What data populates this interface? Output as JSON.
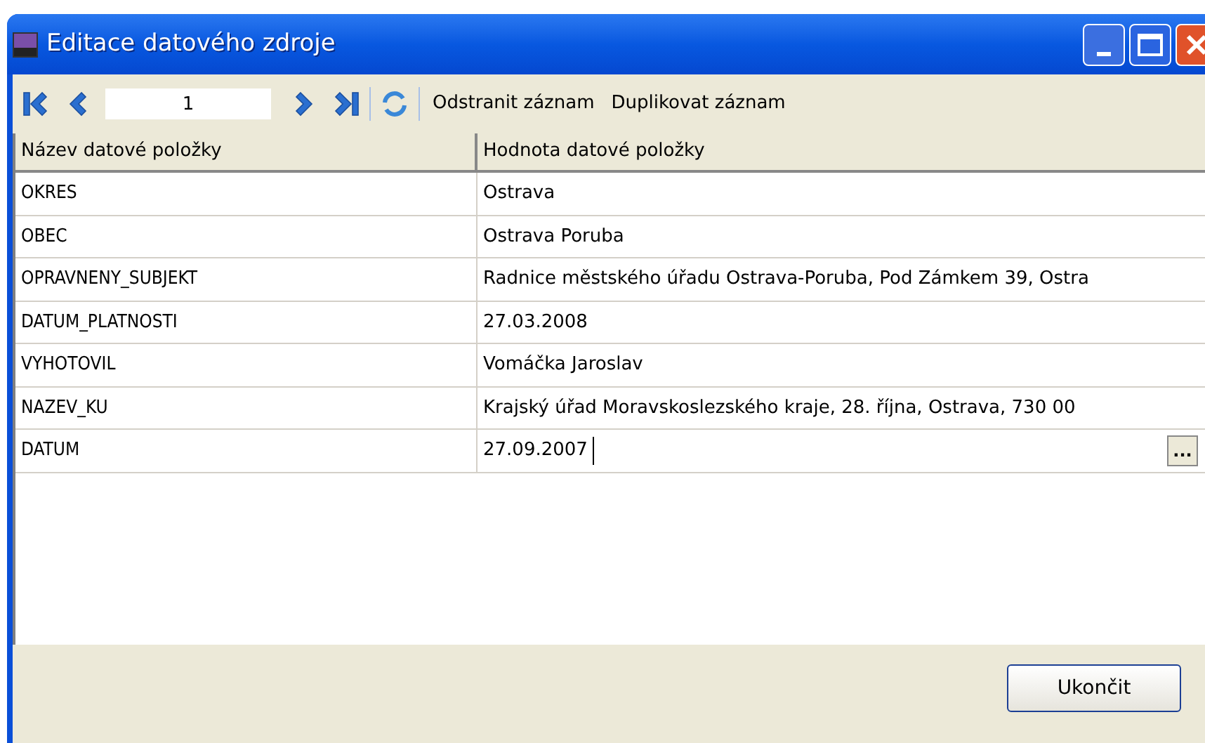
{
  "window": {
    "title": "Editace datového zdroje"
  },
  "toolbar": {
    "record": "1",
    "actions": [
      "Odstranit záznam",
      "Duplikovat záznam"
    ]
  },
  "table": {
    "columns": [
      "Název datové položky",
      "Hodnota datové položky"
    ],
    "rows": [
      {
        "name": "OKRES",
        "value": "Ostrava",
        "editing": false
      },
      {
        "name": "OBEC",
        "value": "Ostrava Poruba",
        "editing": false
      },
      {
        "name": "OPRAVNENY_SUBJEKT",
        "value": "Radnice městského úřadu Ostrava-Poruba, Pod Zámkem 39, Ostra",
        "editing": false
      },
      {
        "name": "DATUM_PLATNOSTI",
        "value": "27.03.2008",
        "editing": false
      },
      {
        "name": "VYHOTOVIL",
        "value": "Vomáčka Jaroslav",
        "editing": false
      },
      {
        "name": "NAZEV_KU",
        "value": "Krajský úřad Moravskoslezského kraje, 28. října, Ostrava, 730 00",
        "editing": false
      },
      {
        "name": "DATUM",
        "value": "27.09.2007",
        "editing": true
      }
    ]
  },
  "browse_button": "...",
  "buttons": [
    "Ukončit"
  ]
}
